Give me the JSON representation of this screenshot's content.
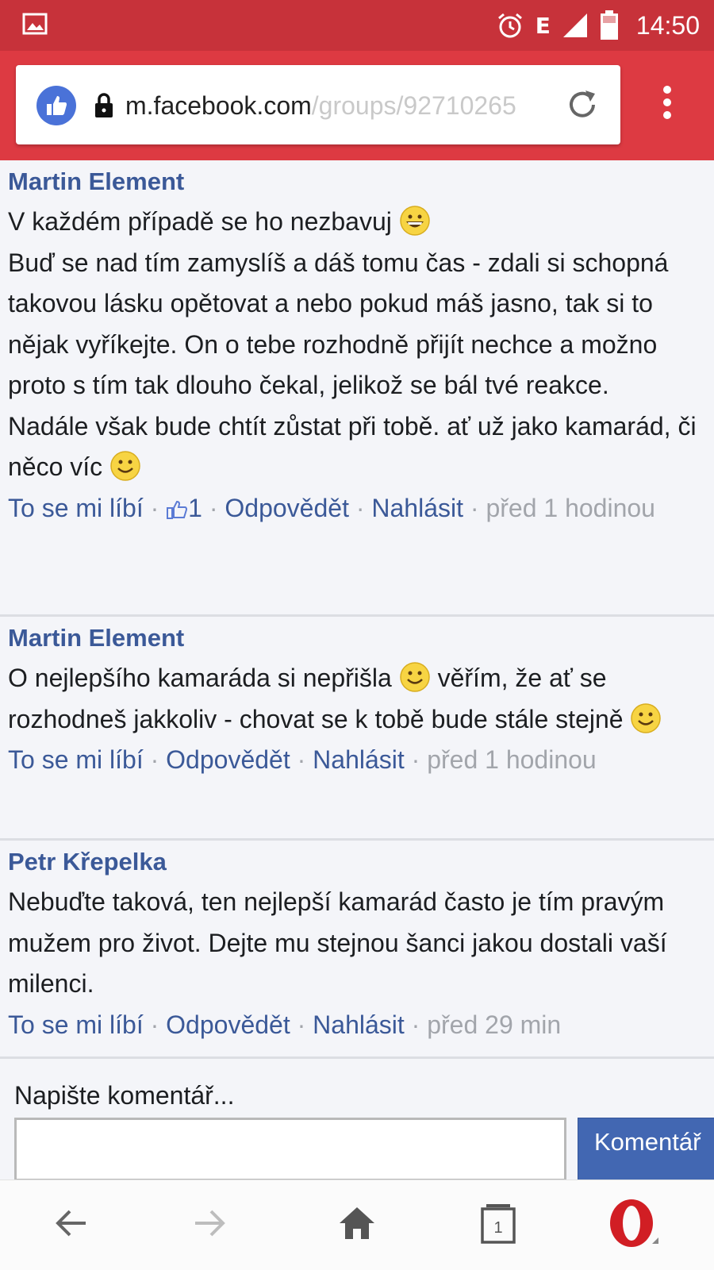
{
  "status_bar": {
    "network": "E",
    "time": "14:50"
  },
  "address_bar": {
    "domain": "m.facebook.com",
    "path": "/groups/92710265"
  },
  "comments": [
    {
      "author": "Martin Element",
      "paragraphs": [
        "V každém případě se ho nezbavuj",
        "Buď se nad tím zamyslíš a dáš tomu čas - zdali si schopná takovou lásku opětovat a nebo pokud máš jasno, tak si to nějak vyříkejte. On o tebe rozhodně přijít nechce a možno proto s tím tak dlouho čekal, jelikož se bál tvé reakce.",
        "Nadále však bude chtít zůstat při tobě. ať už jako kamarád, či něco víc"
      ],
      "like_label": "To se mi líbí",
      "like_count": "1",
      "reply_label": "Odpovědět",
      "report_label": "Nahlásit",
      "time": "před 1 hodinou"
    },
    {
      "author": "Martin Element",
      "text_part1": "O nejlepšího kamaráda si nepřišla",
      "text_part2": "věřím, že ať se rozhodneš jakkoliv - chovat se k tobě bude stále stejně",
      "like_label": "To se mi líbí",
      "reply_label": "Odpovědět",
      "report_label": "Nahlásit",
      "time": "před 1 hodinou"
    },
    {
      "author": "Petr Křepelka",
      "text": "Nebuďte taková, ten nejlepší kamarád často je tím pravým mužem pro život. Dejte mu stejnou šanci jakou dostali vaší milenci.",
      "like_label": "To se mi líbí",
      "reply_label": "Odpovědět",
      "report_label": "Nahlásit",
      "time": "před 29 min"
    }
  ],
  "compose": {
    "label": "Napište komentář...",
    "button": "Komentář"
  },
  "bottom_nav": {
    "tabs_count": "1",
    "icons": [
      "back-arrow-icon",
      "forward-arrow-icon",
      "home-icon",
      "tabs-icon",
      "opera-logo-icon"
    ]
  },
  "colors": {
    "status_bar": "#c7323a",
    "toolbar": "#dd3a42",
    "link": "#3b5998",
    "button": "#4267b2"
  }
}
